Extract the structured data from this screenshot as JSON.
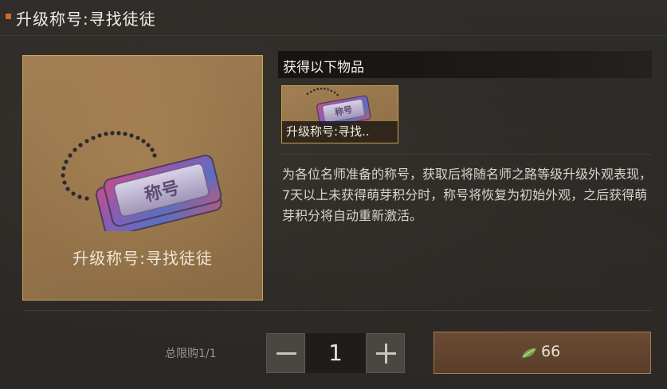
{
  "header": {
    "title": "升级称号:寻找徒徒"
  },
  "item_preview": {
    "name": "升级称号:寻找徒徒",
    "tag_text": "称号"
  },
  "rewards": {
    "heading": "获得以下物品",
    "items": [
      {
        "label": "升级称号:寻找..",
        "tag_text": "称号"
      }
    ]
  },
  "description": "为各位名师准备的称号，获取后将随名师之路等级升级外观表现，7天以上未获得萌芽积分时，称号将恢复为初始外观，之后获得萌芽积分将自动重新激活。",
  "purchase": {
    "limit_text": "总限购1/1",
    "quantity": "1",
    "price": "66",
    "currency_icon": "leaf-icon"
  },
  "colors": {
    "accent": "#d2692c",
    "gold_border": "#c9a95a",
    "button_bg": "#5a3e2b"
  }
}
